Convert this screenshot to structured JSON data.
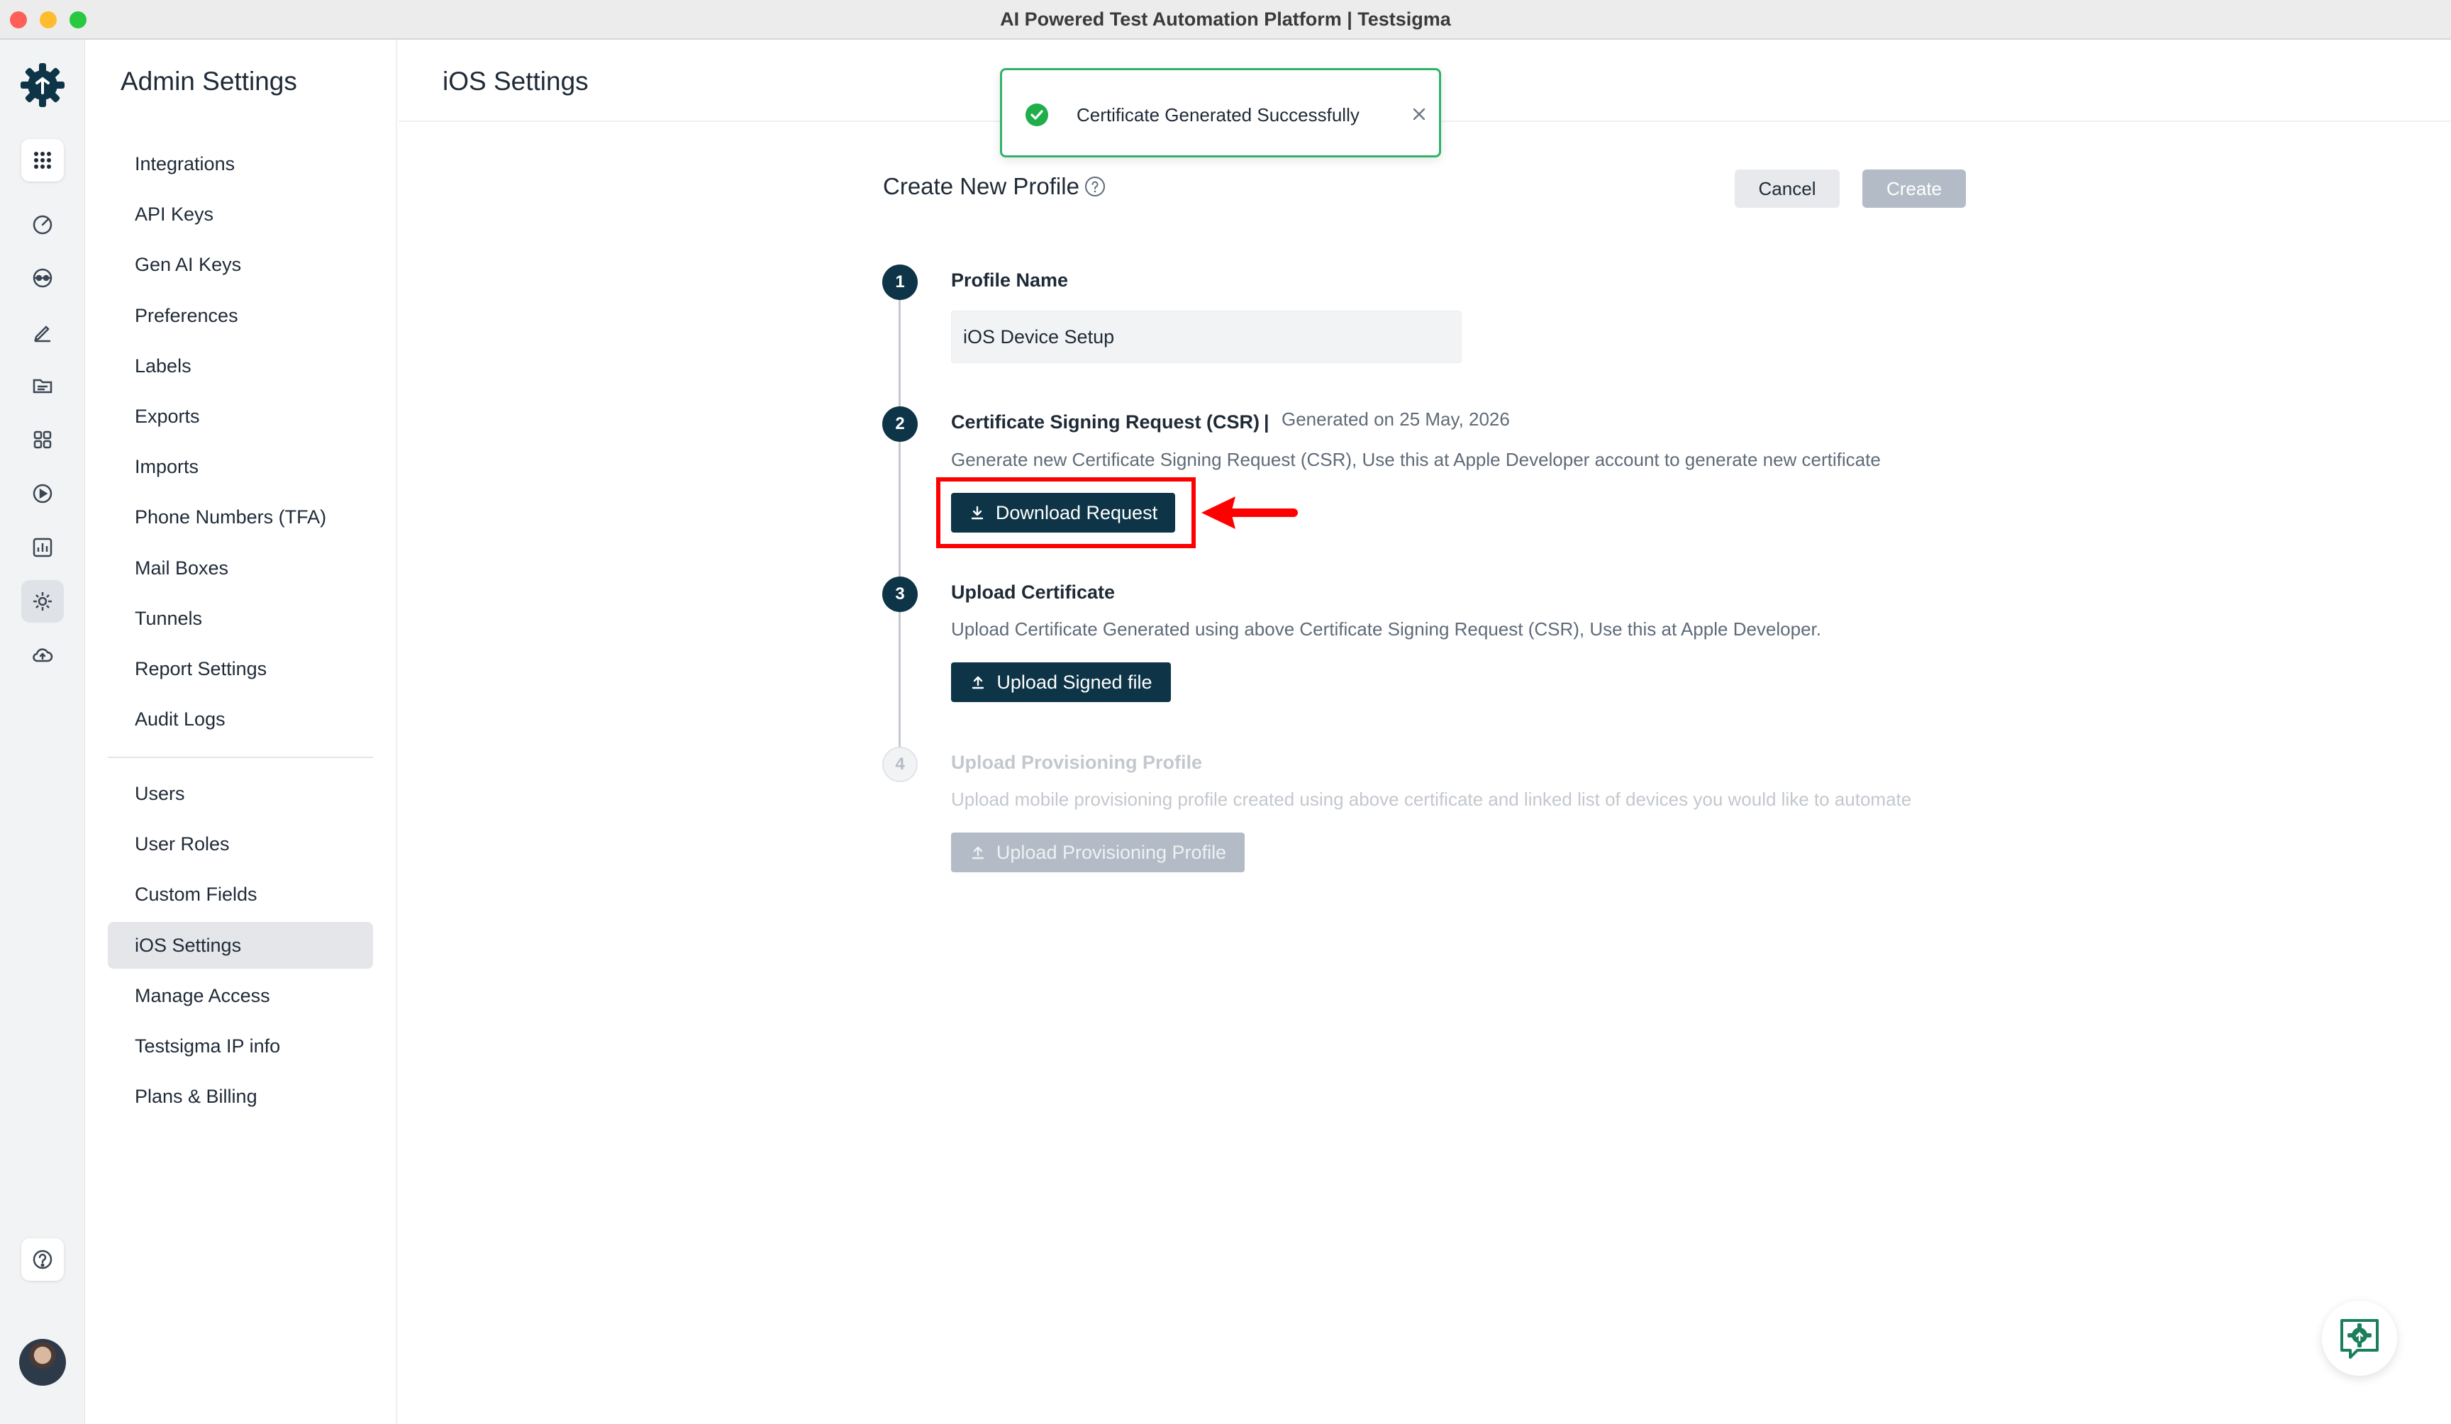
{
  "window": {
    "title": "AI Powered Test Automation Platform | Testsigma"
  },
  "rail": {
    "icons": [
      "testsigma-logo-icon",
      "apps-grid-icon",
      "dashboard-gauge-icon",
      "visibility-eye-icon",
      "pencil-edit-icon",
      "folder-list-icon",
      "modules-grid-icon",
      "run-play-icon",
      "reports-chart-icon",
      "settings-gear-icon",
      "cloud-upload-icon",
      "help-question-icon",
      "user-avatar"
    ]
  },
  "sidebar": {
    "title": "Admin Settings",
    "items": [
      {
        "label": "Integrations"
      },
      {
        "label": "API Keys"
      },
      {
        "label": "Gen AI Keys"
      },
      {
        "label": "Preferences"
      },
      {
        "label": "Labels"
      },
      {
        "label": "Exports"
      },
      {
        "label": "Imports"
      },
      {
        "label": "Phone Numbers (TFA)"
      },
      {
        "label": "Mail Boxes"
      },
      {
        "label": "Tunnels"
      },
      {
        "label": "Report Settings"
      },
      {
        "label": "Audit Logs"
      },
      {
        "label": "Users"
      },
      {
        "label": "User Roles"
      },
      {
        "label": "Custom Fields"
      },
      {
        "label": "iOS Settings"
      },
      {
        "label": "Manage Access"
      },
      {
        "label": "Testsigma IP info"
      },
      {
        "label": "Plans & Billing"
      }
    ],
    "active": "iOS Settings"
  },
  "main": {
    "title": "iOS Settings",
    "toast": {
      "message": "Certificate Generated Successfully",
      "status_color": "#2fb36b"
    },
    "form": {
      "title": "Create New Profile",
      "cancel_label": "Cancel",
      "create_label": "Create",
      "steps": [
        {
          "number": "1",
          "label": "Profile Name",
          "input_value": "iOS Device Setup"
        },
        {
          "number": "2",
          "label": "Certificate Signing Request (CSR)",
          "separator": "|",
          "generated": "Generated on 25 May, 2026",
          "description": "Generate new Certificate Signing Request (CSR), Use this at Apple Developer account to generate new certificate",
          "button": "Download Request"
        },
        {
          "number": "3",
          "label": "Upload Certificate",
          "description": "Upload Certificate Generated using above Certificate Signing Request (CSR), Use this at Apple Developer.",
          "button": "Upload Signed file"
        },
        {
          "number": "4",
          "label": "Upload Provisioning Profile",
          "description": "Upload mobile provisioning profile created using above certificate and linked list of devices you would like to automate",
          "button": "Upload Provisioning Profile"
        }
      ]
    }
  },
  "colors": {
    "primary": "#0d3447",
    "accent_green": "#1a7f5a",
    "highlight": "#ff0000",
    "disabled": "#b3bcc6"
  }
}
